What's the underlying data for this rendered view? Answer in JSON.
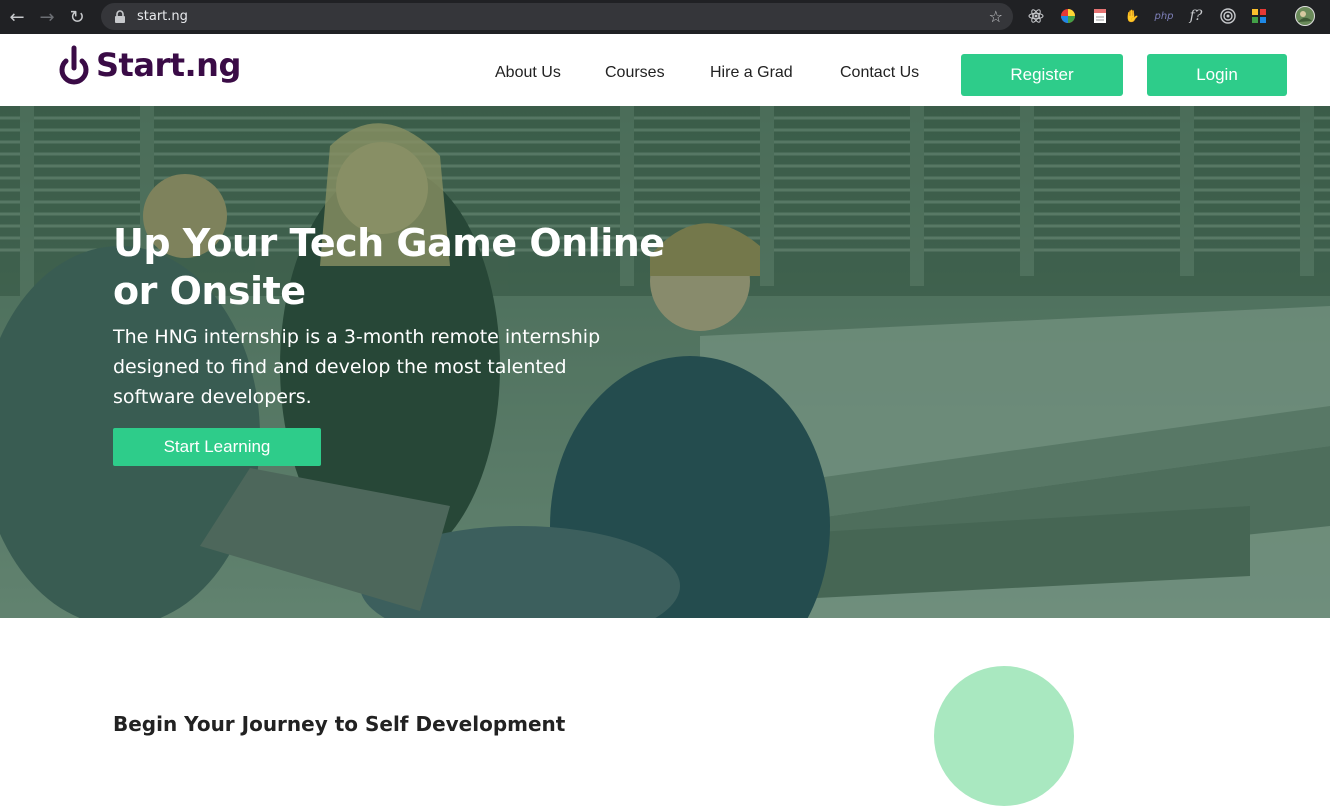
{
  "browser": {
    "url": "start.ng",
    "icons": [
      "back-icon",
      "forward-icon",
      "reload-icon",
      "lock-icon",
      "star-icon"
    ],
    "extensions": [
      "react-devtools-icon",
      "color-picker-icon",
      "notes-icon",
      "hand-icon",
      "php-icon",
      "formula-icon",
      "target-icon",
      "grid-icon",
      "profile-avatar"
    ],
    "extension_php_label": "php",
    "extension_formula_label": "f?"
  },
  "header": {
    "logo_text": "Start.ng",
    "nav": [
      {
        "label": "About Us"
      },
      {
        "label": "Courses"
      },
      {
        "label": "Hire a Grad"
      },
      {
        "label": "Contact Us"
      }
    ],
    "register_label": "Register",
    "login_label": "Login"
  },
  "hero": {
    "title": "Up Your Tech Game Online or Onsite",
    "subtitle": "The HNG internship is a 3-month remote internship designed to find and develop the most talented software developers.",
    "cta_label": "Start Learning"
  },
  "section": {
    "title": "Begin Your Journey to Self Development"
  },
  "colors": {
    "brand_purple": "#3a0b46",
    "accent_green": "#2ecc8a",
    "chrome_dark": "#202124",
    "circle_green": "#a9e8c0"
  }
}
